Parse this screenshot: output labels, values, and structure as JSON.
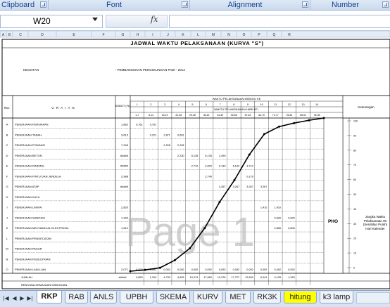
{
  "ribbon": {
    "groups": [
      "Clipboard",
      "Font",
      "Alignment",
      "Number"
    ]
  },
  "formula_bar": {
    "name_box": "W20",
    "fx_label": "fx",
    "formula": ""
  },
  "sheet": {
    "column_headers": [
      "A",
      "B",
      "C",
      "D",
      "E",
      "F",
      "G",
      "H",
      "I",
      "J",
      "K",
      "L",
      "M",
      "N",
      "O",
      "P",
      "Q",
      "R"
    ],
    "title": "JADWAL WAKTU PELAKSANAAN (KURVA \"S\")",
    "kegiatan_label": "KEGIATAN",
    "kegiatan_value": ": PEMBANGUNAN PENGGILINGAN PADI - 2013",
    "header": {
      "no": "NO.",
      "uraian": "U R A I A N",
      "bobot": "BOBOT (%)",
      "waktu_minggu": "WAKTU PELAKSANAAN MINGGU KE",
      "waktu_hari": "WAKTU PELAKSANAAN HARI KE :",
      "keterangan": "Keterangan",
      "week_numbers": [
        "1",
        "2",
        "3",
        "4",
        "5",
        "6",
        "7",
        "8",
        "9",
        "10",
        "11",
        "12",
        "13",
        "14"
      ],
      "day_ranges": [
        "1-7",
        "8-14",
        "15-21",
        "22-28",
        "29-35",
        "36-42",
        "43-49",
        "50-56",
        "57-63",
        "64-70",
        "71-77",
        "78-84",
        "85-91",
        "92-98"
      ]
    },
    "rows": [
      {
        "no": "A",
        "item": "PEKERJAAN PERSIAPAN",
        "bobot": "1,862",
        "weeks": [
          "0,761",
          "0,761",
          "",
          "",
          "",
          "",
          "",
          "",
          "",
          "",
          "",
          "",
          "",
          ""
        ]
      },
      {
        "no": "B",
        "item": "PEKERJAAN TANAH",
        "bobot": "3,613",
        "weeks": [
          "",
          "0,221",
          "2,871",
          "0,661",
          "",
          "",
          "",
          "",
          "",
          "",
          "",
          "",
          "",
          ""
        ]
      },
      {
        "no": "C",
        "item": "PEKERJAAN PONDASI",
        "bobot": "7,345",
        "weeks": [
          "",
          "",
          "2,228",
          "2,228",
          "",
          "",
          "",
          "",
          "",
          "",
          "",
          "",
          "",
          ""
        ]
      },
      {
        "no": "D",
        "item": "PEKERJAAN BETON",
        "bobot": "#####",
        "weeks": [
          "",
          "",
          "",
          "2,230",
          "5,135",
          "5,135",
          "2,490",
          "",
          "",
          "",
          "",
          "",
          "",
          ""
        ]
      },
      {
        "no": "E",
        "item": "PEKERJAAN DINDING",
        "bobot": "#####",
        "weeks": [
          "",
          "",
          "",
          "",
          "2,710",
          "2,820",
          "6,132",
          "6,132",
          "3,710",
          "",
          "",
          "",
          "",
          ""
        ]
      },
      {
        "no": "F",
        "item": "PEKERJAAN PINTU DAN JENDELA",
        "bobot": "2,988",
        "weeks": [
          "",
          "",
          "",
          "",
          "",
          "2,746",
          "",
          "",
          "0,176",
          "",
          "",
          "",
          "",
          ""
        ]
      },
      {
        "no": "G",
        "item": "PEKERJAAN ATAP",
        "bobot": "#####",
        "weeks": [
          "",
          "",
          "",
          "",
          "",
          "",
          "3,267",
          "3,267",
          "3,267",
          "3,267",
          "",
          "",
          "",
          ""
        ]
      },
      {
        "no": "H",
        "item": "PEKERJAAN KAYU",
        "bobot": "",
        "weeks": [
          "",
          "",
          "",
          "",
          "",
          "",
          "",
          "",
          "",
          "",
          "",
          "",
          "",
          ""
        ]
      },
      {
        "no": "I",
        "item": "PEKERJAAN LANTAI",
        "bobot": "2,820",
        "weeks": [
          "",
          "",
          "",
          "",
          "",
          "",
          "",
          "",
          "",
          "1,410",
          "1,410",
          "",
          "",
          ""
        ]
      },
      {
        "no": "J",
        "item": "PEKERJAAN SANITASI",
        "bobot": "1,340",
        "weeks": [
          "",
          "",
          "",
          "",
          "",
          "",
          "",
          "",
          "",
          "",
          "0,620",
          "0,620",
          "",
          ""
        ]
      },
      {
        "no": "K",
        "item": "PEKERJAAN MECHANICAL ELECTRICAL",
        "bobot": "1,612",
        "weeks": [
          "",
          "",
          "",
          "",
          "",
          "",
          "",
          "",
          "",
          "",
          "0,806",
          "0,806",
          "",
          ""
        ]
      },
      {
        "no": "L",
        "item": "PEKERJAAN PENGECATAN",
        "bobot": "",
        "weeks": [
          "",
          "",
          "",
          "",
          "",
          "",
          "",
          "",
          "",
          "",
          "",
          "",
          "",
          ""
        ]
      },
      {
        "no": "M",
        "item": "PEKERJAAN PAGAR",
        "bobot": "",
        "weeks": [
          "",
          "",
          "",
          "",
          "",
          "",
          "",
          "",
          "",
          "",
          "",
          "",
          "",
          ""
        ]
      },
      {
        "no": "N",
        "item": "PEKERJAAN PEDESTRIAN",
        "bobot": "",
        "weeks": [
          "",
          "",
          "",
          "",
          "",
          "",
          "",
          "",
          "",
          "",
          "",
          "",
          "",
          ""
        ]
      },
      {
        "no": "O",
        "item": "PEKERJAAN LAIN-LAIN",
        "bobot": "2,071",
        "weeks": [
          "0,092",
          "0,092",
          "0,092",
          "0,092",
          "0,092",
          "0,092",
          "0,092",
          "0,092",
          "0,092",
          "0,092",
          "0,092",
          "0,092",
          "",
          ""
        ]
      }
    ],
    "jumlah_label": "JUMLAH",
    "jumlah_bobot": "#####",
    "rencana_label": "RENCANA KEMAJUAN MINGGUAN",
    "rencana_values": [
      "0,853",
      "1,310",
      "4,733",
      "4,693",
      "10,074",
      "17,960",
      "12,976",
      "17,727",
      "12,500",
      "6,041",
      "0,133",
      "1,263",
      "",
      ""
    ],
    "pho": "PHO",
    "keterangan_note": "Jangka Waktu Pelaksanaan 90 (Sembilan Puluh) Hari Kalender",
    "watermark": "Page 1",
    "pct_ticks": [
      "100",
      "90",
      "80",
      "70",
      "60",
      "50",
      "40",
      "30",
      "20",
      "10",
      "0"
    ]
  },
  "chart_data": {
    "type": "line",
    "title": "",
    "x": [
      0,
      1,
      2,
      3,
      4,
      5,
      6,
      7,
      8,
      9,
      10,
      11,
      12,
      13
    ],
    "series": [
      {
        "name": "",
        "values": [
          0,
          0.85,
          2.2,
          7.2,
          14.9,
          28.1,
          45.1,
          59.5,
          76.1,
          89.5,
          94.4,
          96.7,
          98.5,
          100
        ]
      }
    ],
    "ylim": [
      0,
      100
    ]
  },
  "tabs": {
    "items": [
      "RKP",
      "RAB",
      "ANLS",
      "UPBH",
      "SKEMA",
      "KURV",
      "MET",
      "RK3K",
      "hitung",
      "k3 lamp"
    ],
    "active": "RKP"
  },
  "colors": {
    "ribbon_text": "#15428b",
    "highlight_tab": "#ffff00",
    "curve": "#000000"
  }
}
